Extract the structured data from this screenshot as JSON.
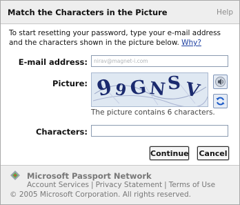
{
  "header": {
    "title": "Match the Characters in the Picture",
    "help": "Help"
  },
  "intro": {
    "text": "To start resetting your password, type your e-mail address and the characters shown in the picture below.",
    "link": "Why?"
  },
  "form": {
    "email_label": "E-mail address:",
    "email_value": "nirav@magnet-i.com",
    "picture_label": "Picture:",
    "captcha_chars": [
      "9",
      "9",
      "G",
      "N",
      "S",
      "V"
    ],
    "picture_caption": "The picture contains 6 characters.",
    "characters_label": "Characters:",
    "characters_value": ""
  },
  "buttons": {
    "continue": "Continue",
    "cancel": "Cancel"
  },
  "footer": {
    "brand": "Microsoft Passport Network",
    "links": [
      "Account Services",
      "Privacy Statement",
      "Terms of Use"
    ],
    "separator": "|",
    "copyright": "© 2005 Microsoft Corporation. All rights reserved."
  },
  "icons": {
    "audio": "speaker-icon",
    "refresh": "refresh-icon",
    "logo": "passport-logo-icon"
  },
  "colors": {
    "link": "#1a3da0",
    "captcha_text": "#1b2a6e",
    "header_bg": "#eeeeee"
  }
}
